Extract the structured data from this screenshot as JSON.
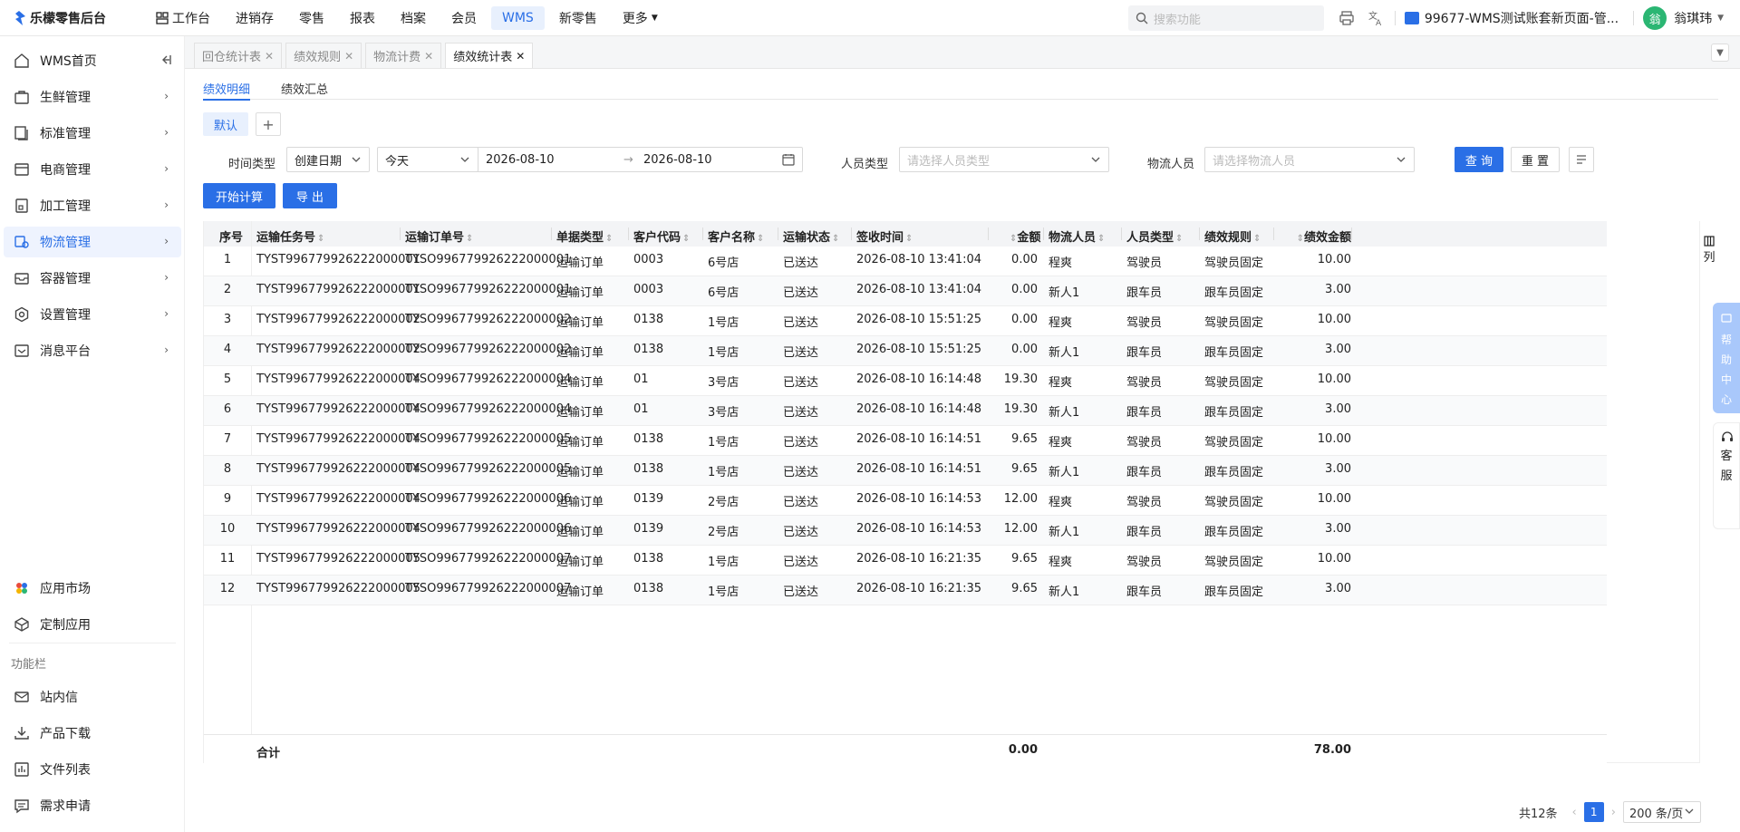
{
  "app": {
    "title": "乐檬零售后台"
  },
  "topnav": {
    "items": [
      {
        "label": "工作台"
      },
      {
        "label": "进销存"
      },
      {
        "label": "零售"
      },
      {
        "label": "报表"
      },
      {
        "label": "档案"
      },
      {
        "label": "会员"
      },
      {
        "label": "WMS"
      },
      {
        "label": "新零售"
      },
      {
        "label": "更多"
      }
    ],
    "active": "WMS"
  },
  "search": {
    "placeholder": "搜索功能"
  },
  "company": {
    "label": "99677-WMS测试账套新页面-管..."
  },
  "user": {
    "name": "翁琪玮",
    "avatar_text": "翁"
  },
  "sidebar": {
    "items": [
      {
        "label": "WMS首页"
      },
      {
        "label": "生鲜管理"
      },
      {
        "label": "标准管理"
      },
      {
        "label": "电商管理"
      },
      {
        "label": "加工管理"
      },
      {
        "label": "物流管理"
      },
      {
        "label": "容器管理"
      },
      {
        "label": "设置管理"
      },
      {
        "label": "消息平台"
      }
    ],
    "bottom_items": [
      {
        "label": "应用市场"
      },
      {
        "label": "定制应用"
      }
    ],
    "group_label": "功能栏",
    "tools": [
      {
        "label": "站内信"
      },
      {
        "label": "产品下载"
      },
      {
        "label": "文件列表"
      },
      {
        "label": "需求申请"
      }
    ]
  },
  "tabs": [
    {
      "label": "回仓统计表"
    },
    {
      "label": "绩效规则"
    },
    {
      "label": "物流计费"
    },
    {
      "label": "绩效统计表"
    }
  ],
  "subtabs": [
    {
      "label": "绩效明细"
    },
    {
      "label": "绩效汇总"
    }
  ],
  "view": {
    "default_label": "默认",
    "add_label": "+"
  },
  "filters": {
    "time_type_label": "时间类型",
    "time_type_value": "创建日期",
    "period_value": "今天",
    "date_start": "2026-08-10",
    "date_sep": "→",
    "date_end": "2026-08-10",
    "person_type_label": "人员类型",
    "person_type_placeholder": "请选择人员类型",
    "logistics_person_label": "物流人员",
    "logistics_person_placeholder": "请选择物流人员",
    "query_label": "查 询",
    "reset_label": "重 置"
  },
  "actions": {
    "calc_label": "开始计算",
    "export_label": "导 出"
  },
  "table": {
    "columns": [
      "序号",
      "运输任务号",
      "运输订单号",
      "单据类型",
      "客户代码",
      "客户名称",
      "运输状态",
      "签收时间",
      "金额",
      "物流人员",
      "人员类型",
      "绩效规则",
      "绩效金额"
    ],
    "rows": [
      [
        "1",
        "TYST996779926222000001",
        "TYSO996779926222000001",
        "运输订单",
        "0003",
        "6号店",
        "已送达",
        "2026-08-10 13:41:04",
        "0.00",
        "程爽",
        "驾驶员",
        "驾驶员固定",
        "10.00"
      ],
      [
        "2",
        "TYST996779926222000001",
        "TYSO996779926222000001",
        "运输订单",
        "0003",
        "6号店",
        "已送达",
        "2026-08-10 13:41:04",
        "0.00",
        "新人1",
        "跟车员",
        "跟车员固定",
        "3.00"
      ],
      [
        "3",
        "TYST996779926222000002",
        "TYSO996779926222000002",
        "运输订单",
        "0138",
        "1号店",
        "已送达",
        "2026-08-10 15:51:25",
        "0.00",
        "程爽",
        "驾驶员",
        "驾驶员固定",
        "10.00"
      ],
      [
        "4",
        "TYST996779926222000002",
        "TYSO996779926222000002",
        "运输订单",
        "0138",
        "1号店",
        "已送达",
        "2026-08-10 15:51:25",
        "0.00",
        "新人1",
        "跟车员",
        "跟车员固定",
        "3.00"
      ],
      [
        "5",
        "TYST996779926222000004",
        "TYSO996779926222000004",
        "运输订单",
        "01",
        "3号店",
        "已送达",
        "2026-08-10 16:14:48",
        "19.30",
        "程爽",
        "驾驶员",
        "驾驶员固定",
        "10.00"
      ],
      [
        "6",
        "TYST996779926222000004",
        "TYSO996779926222000004",
        "运输订单",
        "01",
        "3号店",
        "已送达",
        "2026-08-10 16:14:48",
        "19.30",
        "新人1",
        "跟车员",
        "跟车员固定",
        "3.00"
      ],
      [
        "7",
        "TYST996779926222000004",
        "TYSO996779926222000005",
        "运输订单",
        "0138",
        "1号店",
        "已送达",
        "2026-08-10 16:14:51",
        "9.65",
        "程爽",
        "驾驶员",
        "驾驶员固定",
        "10.00"
      ],
      [
        "8",
        "TYST996779926222000004",
        "TYSO996779926222000005",
        "运输订单",
        "0138",
        "1号店",
        "已送达",
        "2026-08-10 16:14:51",
        "9.65",
        "新人1",
        "跟车员",
        "跟车员固定",
        "3.00"
      ],
      [
        "9",
        "TYST996779926222000004",
        "TYSO996779926222000006",
        "运输订单",
        "0139",
        "2号店",
        "已送达",
        "2026-08-10 16:14:53",
        "12.00",
        "程爽",
        "驾驶员",
        "驾驶员固定",
        "10.00"
      ],
      [
        "10",
        "TYST996779926222000004",
        "TYSO996779926222000006",
        "运输订单",
        "0139",
        "2号店",
        "已送达",
        "2026-08-10 16:14:53",
        "12.00",
        "新人1",
        "跟车员",
        "跟车员固定",
        "3.00"
      ],
      [
        "11",
        "TYST996779926222000005",
        "TYSO996779926222000007",
        "运输订单",
        "0138",
        "1号店",
        "已送达",
        "2026-08-10 16:21:35",
        "9.65",
        "程爽",
        "驾驶员",
        "驾驶员固定",
        "10.00"
      ],
      [
        "12",
        "TYST996779926222000005",
        "TYSO996779926222000007",
        "运输订单",
        "0138",
        "1号店",
        "已送达",
        "2026-08-10 16:21:35",
        "9.65",
        "新人1",
        "跟车员",
        "跟车员固定",
        "3.00"
      ]
    ],
    "total_label": "合计",
    "total_amount": "0.00",
    "total_perf": "78.00",
    "column_settings_label": "列"
  },
  "pager": {
    "total": "共12条",
    "page": "1",
    "page_size": "200 条/页"
  },
  "float": {
    "help": [
      "帮",
      "助",
      "中",
      "心"
    ],
    "service": [
      "客",
      "服"
    ]
  },
  "colors": {
    "accent": "#2a6fe6",
    "active_bg": "#e8f0fd"
  }
}
